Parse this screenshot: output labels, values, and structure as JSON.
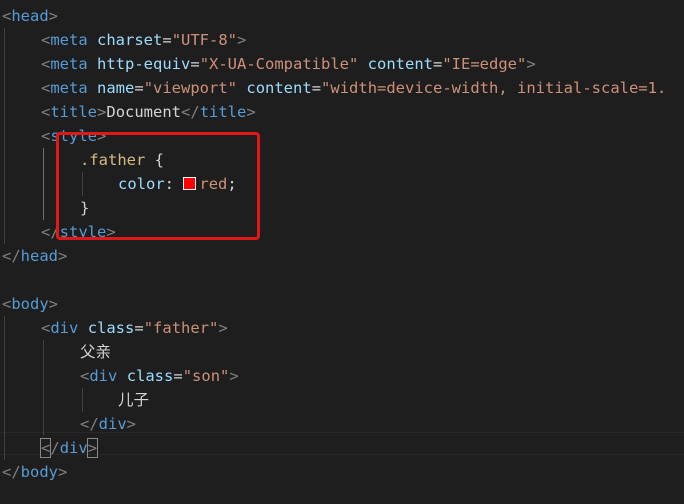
{
  "editor": {
    "language": "html",
    "highlight_color": "#e01818",
    "swatch_color": "#ff0000",
    "tokens": {
      "lt": "<",
      "lts": "</",
      "gt": ">",
      "eq": "=",
      "space": " ",
      "brace_open": "{",
      "brace_close": "}",
      "colon": ":",
      "semicolon": ";",
      "comma": ", "
    },
    "lines": {
      "head_open": {
        "tag": "head"
      },
      "meta_charset": {
        "tag": "meta",
        "attr": "charset",
        "value": "\"UTF-8\""
      },
      "meta_http_equiv": {
        "tag": "meta",
        "attr1": "http-equiv",
        "value1": "\"X-UA-Compatible\"",
        "attr2": "content",
        "value2": "\"IE=edge\""
      },
      "meta_viewport": {
        "tag": "meta",
        "attr1": "name",
        "value1": "\"viewport\"",
        "attr2": "content",
        "value2": "\"width=device-width, initial-scale=1."
      },
      "title": {
        "tag": "title",
        "text": "Document"
      },
      "style_open": {
        "tag": "style"
      },
      "css_selector": {
        "selector": ".father"
      },
      "css_declaration": {
        "property": "color",
        "value": "red"
      },
      "style_close": {
        "tag": "style"
      },
      "head_close": {
        "tag": "head"
      },
      "body_open": {
        "tag": "body"
      },
      "div_father": {
        "tag": "div",
        "attr": "class",
        "value": "\"father\""
      },
      "text_father": {
        "text": "父亲"
      },
      "div_son": {
        "tag": "div",
        "attr": "class",
        "value": "\"son\""
      },
      "text_son": {
        "text": "儿子"
      },
      "div_son_close": {
        "tag": "div"
      },
      "div_father_close": {
        "tag": "div"
      },
      "body_close": {
        "tag": "body"
      }
    }
  }
}
